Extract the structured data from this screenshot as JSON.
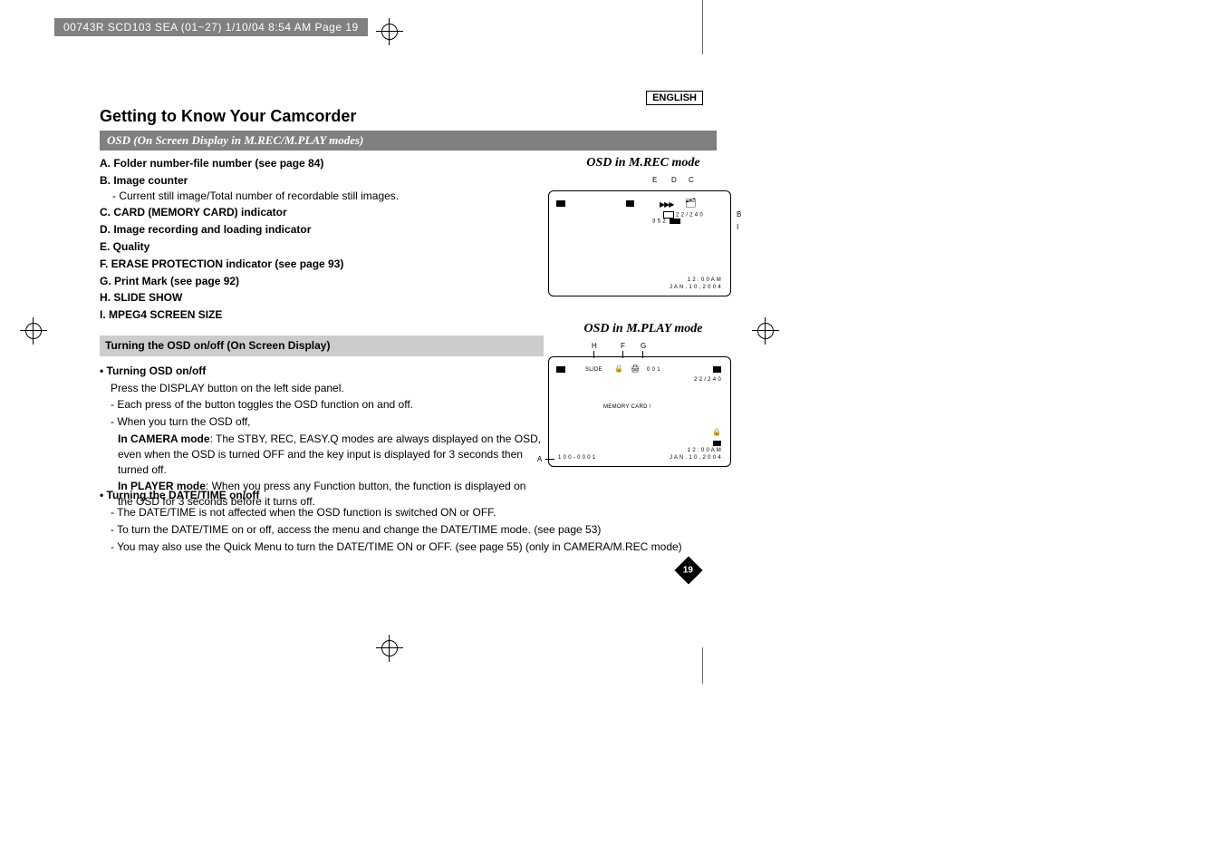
{
  "header_strip": "00743R SCD103 SEA (01~27)  1/10/04 8:54 AM  Page 19",
  "language": "ENGLISH",
  "page_title": "Getting to Know Your Camcorder",
  "subtitle": "OSD (On Screen Display in M.REC/M.PLAY modes)",
  "list": {
    "A": "A. Folder number-file number (see page 84)",
    "B": "B. Image counter",
    "Bsub": "- Current still image/Total number of recordable still images.",
    "C": "C. CARD (MEMORY CARD) indicator",
    "D": "D. Image recording and loading indicator",
    "E": "E. Quality",
    "F": "F. ERASE PROTECTION indicator (see page 93)",
    "G": "G. Print Mark (see page 92)",
    "H": "H. SLIDE SHOW",
    "I": "I.  MPEG4 SCREEN SIZE"
  },
  "gray_heading": "Turning the OSD on/off (On Screen Display)",
  "bullet1_head": "• Turning OSD on/off",
  "bullet1_lines": {
    "l1": "Press the DISPLAY button on the left side panel.",
    "l2": "- Each press of the button toggles the OSD function on and off.",
    "l3": "- When you turn the OSD off,",
    "cam_label": "In CAMERA mode",
    "cam_rest": ": The STBY, REC, EASY.Q modes are always displayed on the OSD, even when the OSD is turned OFF and the key input is displayed for 3 seconds then turned off.",
    "play_label": "In PLAYER mode",
    "play_rest": ": When you press any Function button, the function is displayed on the OSD for 3 seconds before it turns off."
  },
  "bullet2_head": "• Turning the DATE/TIME on/off",
  "bullet2_lines": {
    "l1": "- The DATE/TIME is not affected when the OSD function is switched ON or OFF.",
    "l2": "- To turn the DATE/TIME on or off, access the menu and change the DATE/TIME mode. (see page 53)",
    "l3": "- You may also use the Quick Menu to turn the DATE/TIME ON or OFF. (see page 55) (only in CAMERA/M.REC mode)"
  },
  "osd1_label": "OSD in M.REC mode",
  "osd1": {
    "counter": "2 2 / 2 4 0",
    "size": "3 5 2",
    "time": "1 2 : 0 0 A M",
    "date": "J A N . 1 0 , 2 0 0 4",
    "letters": {
      "E": "E",
      "D": "D",
      "C": "C",
      "B": "B",
      "I": "I"
    }
  },
  "osd2_label": "OSD in M.PLAY mode",
  "osd2": {
    "slide": "SLIDE",
    "num": "0 0 1",
    "counter": "2 2 / 2 4 0",
    "memcard": "MEMORY CARD !",
    "folder": "1 0 0 - 0 0 0 1",
    "time": "1 2 : 0 0 A M",
    "date": "J A N . 1 0 , 2 0 0 4",
    "letters": {
      "H": "H",
      "F": "F",
      "G": "G",
      "A": "A"
    }
  },
  "page_number": "19"
}
